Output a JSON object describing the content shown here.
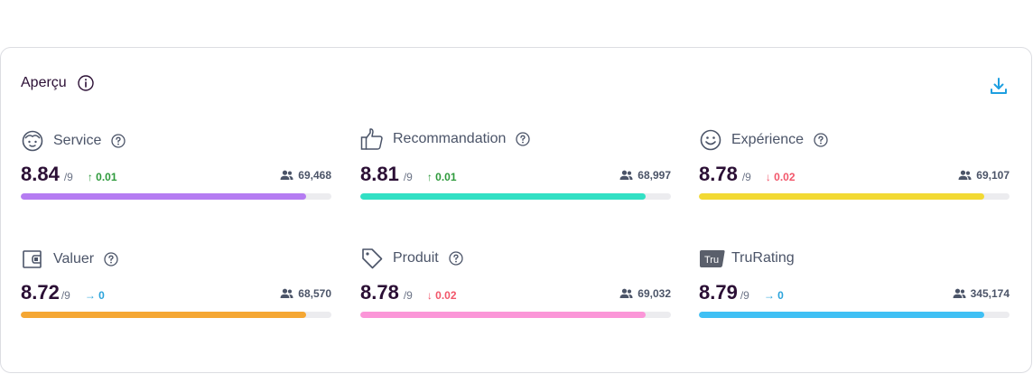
{
  "overview": {
    "title": "Aperçu",
    "info_icon": "info-circle-icon",
    "download_icon": "download-icon"
  },
  "metrics": [
    {
      "key": "service",
      "label": "Service",
      "icon": "face-icon",
      "score": "8.84",
      "scale": "/9",
      "delta": "↑ 0.01",
      "delta_direction": "up",
      "count": "69,468",
      "progress": 0.92,
      "color": "#b57cf2"
    },
    {
      "key": "recommandation",
      "label": "Recommandation",
      "icon": "thumbs-up-icon",
      "score": "8.81",
      "scale": "/9",
      "delta": "↑ 0.01",
      "delta_direction": "up",
      "count": "68,997",
      "progress": 0.92,
      "color": "#32e0c4"
    },
    {
      "key": "experience",
      "label": "Expérience",
      "icon": "smiley-icon",
      "score": "8.78",
      "scale": "/9",
      "delta": "↓ 0.02",
      "delta_direction": "down",
      "count": "69,107",
      "progress": 0.92,
      "color": "#f2d933"
    },
    {
      "key": "valuer",
      "label": "Valuer",
      "icon": "wallet-icon",
      "score": "8.72",
      "scale": "/9",
      "delta": "→ 0",
      "delta_direction": "flat",
      "count": "68,570",
      "progress": 0.92,
      "color": "#f5a733"
    },
    {
      "key": "produit",
      "label": "Produit",
      "icon": "tag-icon",
      "score": "8.78",
      "scale": "/9",
      "delta": "↓ 0.02",
      "delta_direction": "down",
      "count": "69,032",
      "progress": 0.92,
      "color": "#fb96d8"
    },
    {
      "key": "trurating",
      "label": "TruRating",
      "icon": "trurating-logo-icon",
      "score": "8.79",
      "scale": "/9",
      "delta": "→ 0",
      "delta_direction": "flat",
      "count": "345,174",
      "progress": 0.92,
      "color": "#40c0f4"
    }
  ],
  "help_icon": "question-circle-icon",
  "users_icon": "users-icon"
}
